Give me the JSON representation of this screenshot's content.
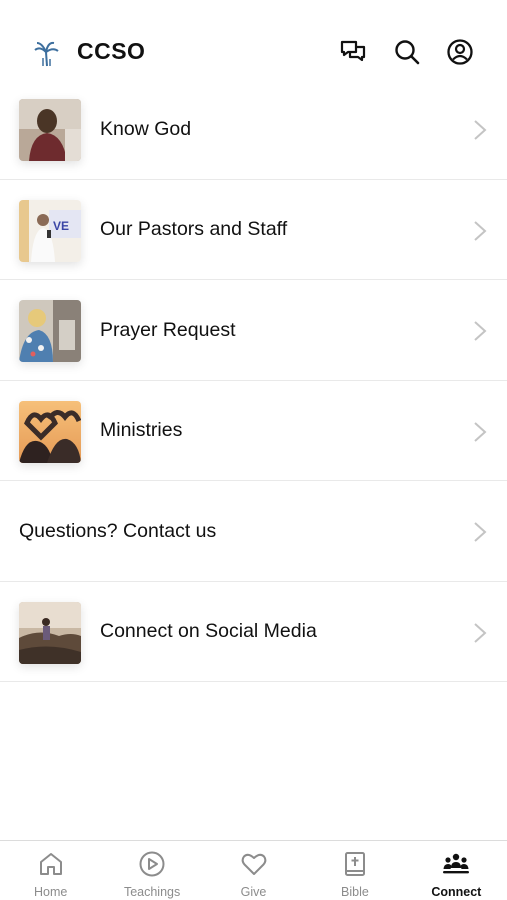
{
  "header": {
    "title": "CCSO",
    "logo_icon": "palm-tree-logo",
    "actions": [
      {
        "name": "messages",
        "icon": "chat-bubbles-icon"
      },
      {
        "name": "search",
        "icon": "search-icon"
      },
      {
        "name": "profile",
        "icon": "user-circle-icon"
      }
    ]
  },
  "list": {
    "items": [
      {
        "label": "Know God",
        "thumbnail": "person-praying-photo"
      },
      {
        "label": "Our Pastors and Staff",
        "thumbnail": "pastor-preaching-photo"
      },
      {
        "label": "Prayer Request",
        "thumbnail": "praying-together-photo"
      },
      {
        "label": "Ministries",
        "thumbnail": "heart-hands-sunset-photo"
      },
      {
        "label": "Questions? Contact us",
        "thumbnail": ""
      },
      {
        "label": "Connect on Social Media",
        "thumbnail": "person-on-hill-photo"
      }
    ]
  },
  "tabbar": {
    "tabs": [
      {
        "label": "Home",
        "icon": "home-icon",
        "active": false
      },
      {
        "label": "Teachings",
        "icon": "play-circle-icon",
        "active": false
      },
      {
        "label": "Give",
        "icon": "heart-icon",
        "active": false
      },
      {
        "label": "Bible",
        "icon": "bible-icon",
        "active": false
      },
      {
        "label": "Connect",
        "icon": "people-group-icon",
        "active": true
      }
    ]
  },
  "colors": {
    "text": "#111111",
    "inactive_tab": "#8c8c8c",
    "divider": "#e9e9e9",
    "chevron": "#c4c4c4",
    "logo_blue": "#3d6f9e"
  }
}
